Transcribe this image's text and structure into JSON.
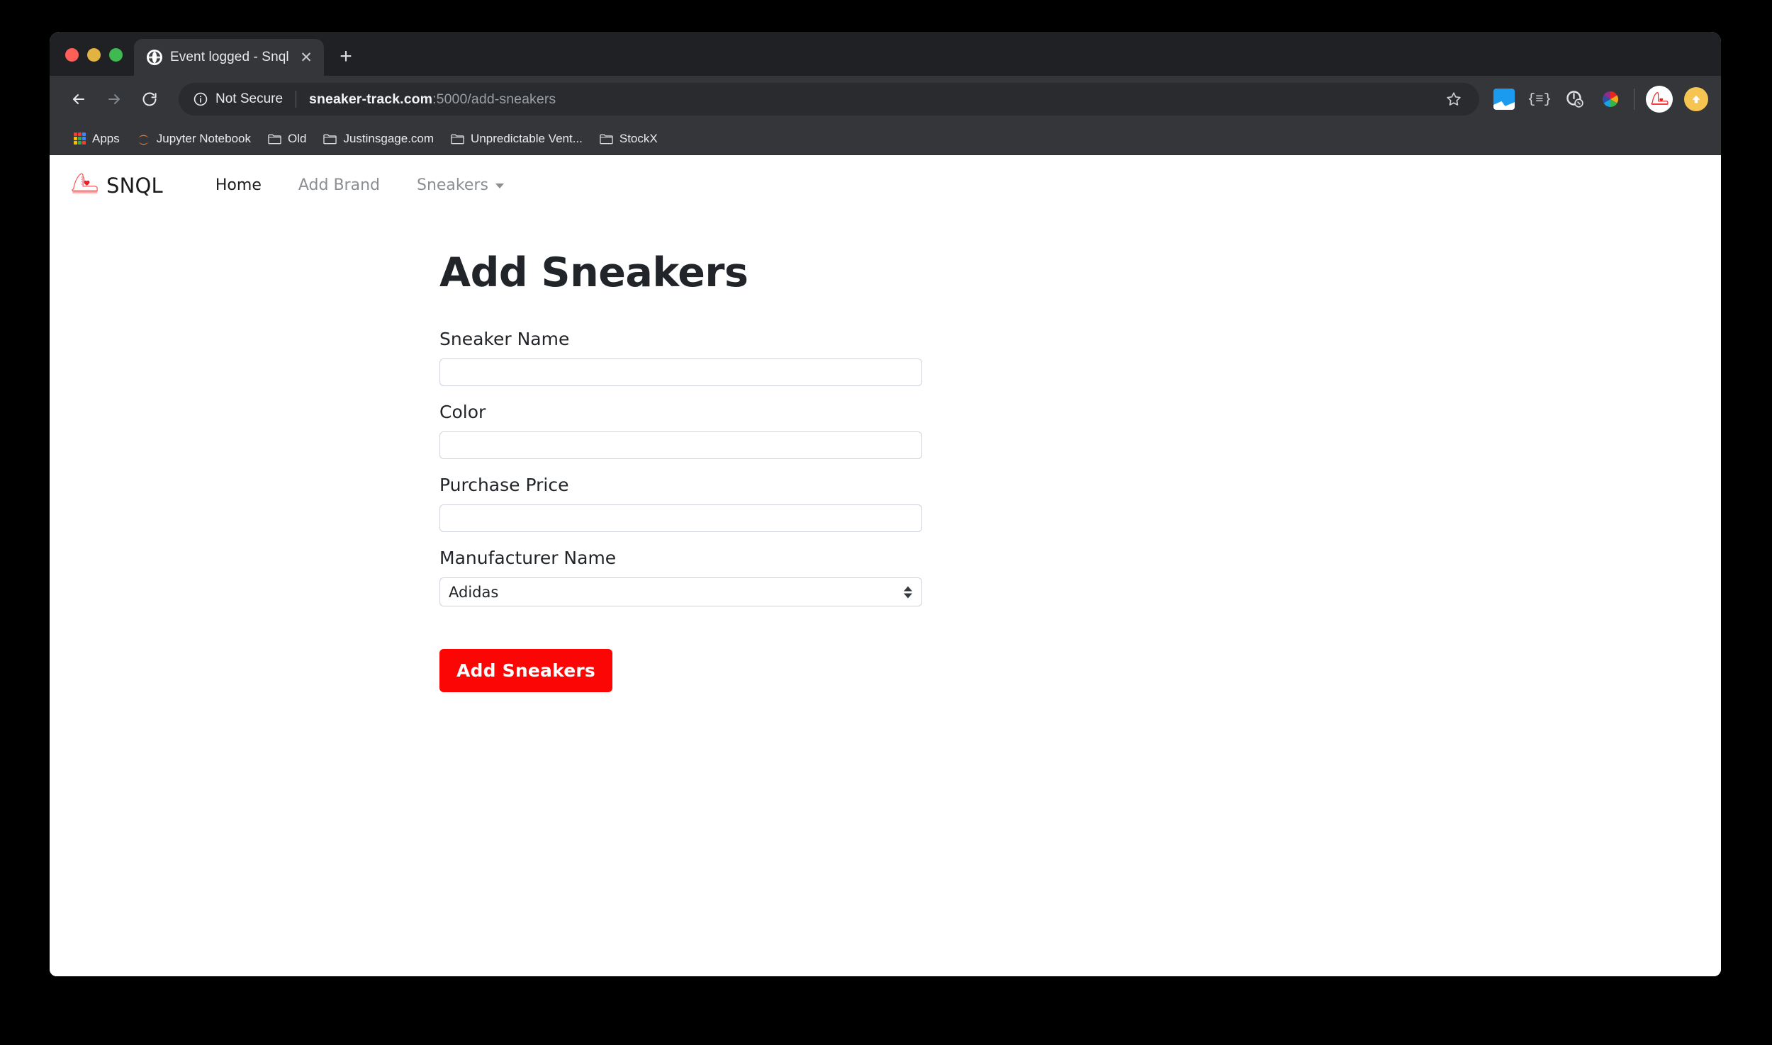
{
  "browser": {
    "traffic_lights": [
      "close",
      "minimize",
      "maximize"
    ],
    "tab": {
      "title": "Event logged - Snql",
      "favicon": "globe-icon",
      "close_label": "✕"
    },
    "new_tab_label": "+",
    "nav": {
      "back": "back-arrow-icon",
      "forward": "forward-arrow-icon",
      "reload": "reload-icon"
    },
    "omnibox": {
      "security_icon": "info-circle-icon",
      "security_text": "Not Secure",
      "url_host": "sneaker-track.com",
      "url_rest": ":5000/add-sneakers",
      "star_icon": "bookmark-star-icon"
    },
    "extensions": [
      {
        "name": "chart-extension-icon"
      },
      {
        "name": "json-viewer-extension-icon",
        "label": "{≡}"
      },
      {
        "name": "time-tracker-extension-icon"
      },
      {
        "name": "color-picker-extension-icon"
      }
    ],
    "profile": {
      "avatar": "sneaker-avatar-icon"
    },
    "update": {
      "icon": "update-arrow-icon"
    },
    "bookmarks": [
      {
        "label": "Apps",
        "icon": "apps-grid-icon"
      },
      {
        "label": "Jupyter Notebook",
        "icon": "jupyter-icon"
      },
      {
        "label": "Old",
        "icon": "folder-icon"
      },
      {
        "label": "Justinsgage.com",
        "icon": "folder-icon"
      },
      {
        "label": "Unpredictable Vent...",
        "icon": "folder-icon"
      },
      {
        "label": "StockX",
        "icon": "folder-icon"
      }
    ]
  },
  "site": {
    "brand": {
      "name": "SNQL",
      "logo": "sneaker-logo-icon"
    },
    "nav_links": [
      {
        "label": "Home",
        "state": "active"
      },
      {
        "label": "Add Brand",
        "state": "muted"
      },
      {
        "label": "Sneakers",
        "state": "muted",
        "dropdown": true
      }
    ]
  },
  "page": {
    "title": "Add Sneakers",
    "fields": [
      {
        "label": "Sneaker Name",
        "value": "",
        "placeholder": "",
        "type": "text"
      },
      {
        "label": "Color",
        "value": "",
        "placeholder": "",
        "type": "text"
      },
      {
        "label": "Purchase Price",
        "value": "",
        "placeholder": "",
        "type": "text"
      }
    ],
    "select_field": {
      "label": "Manufacturer Name",
      "selected": "Adidas",
      "options": [
        "Adidas"
      ]
    },
    "submit_label": "Add Sneakers"
  },
  "colors": {
    "accent_red": "#fb0505",
    "chrome_dark": "#35363a",
    "tabstrip_dark": "#202124",
    "omnibox_dark": "#292b2e",
    "logo_red": "#fa2a2a"
  }
}
